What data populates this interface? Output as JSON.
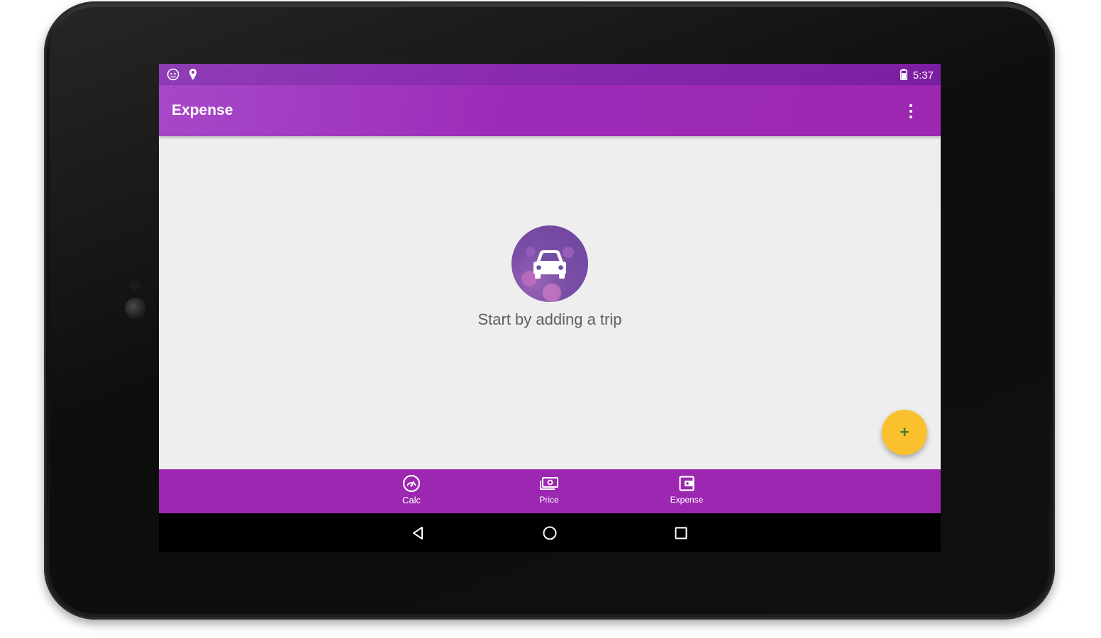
{
  "status_bar": {
    "time": "5:37",
    "left_icons": [
      "android-debug-icon",
      "location-pin-icon"
    ],
    "right_icons": [
      "battery-icon"
    ]
  },
  "app_bar": {
    "title": "Expense",
    "overflow_icon": "more-vert-icon"
  },
  "empty_state": {
    "icon": "car-icon",
    "message": "Start by adding a trip"
  },
  "fab": {
    "icon": "add-icon",
    "symbol": "+"
  },
  "bottom_nav": {
    "items": [
      {
        "label": "Calc",
        "icon": "speedometer-icon"
      },
      {
        "label": "Price",
        "icon": "money-icon"
      },
      {
        "label": "Expense",
        "icon": "wallet-icon"
      }
    ]
  },
  "system_nav": {
    "items": [
      "back-icon",
      "home-icon",
      "recents-icon"
    ]
  },
  "colors": {
    "primary": "#9c27b0",
    "primary_dark": "#7b1fa2",
    "accent": "#fbc02d",
    "background": "#eeeeee"
  }
}
